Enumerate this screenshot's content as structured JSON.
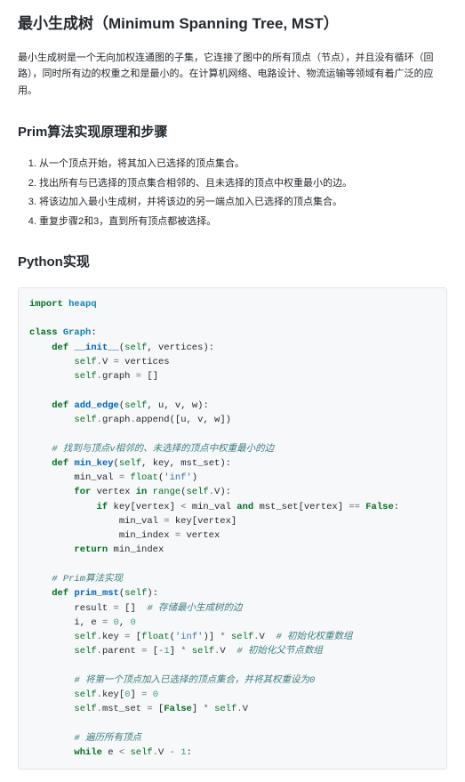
{
  "title": "最小生成树（Minimum Spanning Tree, MST）",
  "intro": "最小生成树是一个无向加权连通图的子集，它连接了图中的所有顶点（节点），并且没有循环（回路），同时所有边的权重之和是最小的。在计算机网络、电路设计、物流运输等领域有着广泛的应用。",
  "section_prim_title": "Prim算法实现原理和步骤",
  "prim_steps": [
    "从一个顶点开始，将其加入已选择的顶点集合。",
    "找出所有与已选择的顶点集合相邻的、且未选择的顶点中权重最小的边。",
    "将该边加入最小生成树，并将该边的另一端点加入已选择的顶点集合。",
    "重复步骤2和3，直到所有顶点都被选择。"
  ],
  "section_python_title": "Python实现",
  "code_tokens": [
    [
      "k",
      "import"
    ],
    [
      "n",
      " "
    ],
    [
      "nn",
      "heapq"
    ],
    [
      "nl",
      ""
    ],
    [
      "nl",
      ""
    ],
    [
      "k",
      "class"
    ],
    [
      "n",
      " "
    ],
    [
      "nc",
      "Graph"
    ],
    [
      "p",
      ":"
    ],
    [
      "nl",
      ""
    ],
    [
      "n",
      "    "
    ],
    [
      "k",
      "def"
    ],
    [
      "n",
      " "
    ],
    [
      "nf",
      "__init__"
    ],
    [
      "p",
      "("
    ],
    [
      "bp",
      "self"
    ],
    [
      "p",
      ","
    ],
    [
      "n",
      " vertices"
    ],
    [
      "p",
      ")"
    ],
    [
      "p",
      ":"
    ],
    [
      "nl",
      ""
    ],
    [
      "n",
      "        "
    ],
    [
      "bp",
      "self"
    ],
    [
      "o",
      "."
    ],
    [
      "n",
      "V "
    ],
    [
      "o",
      "="
    ],
    [
      "n",
      " vertices"
    ],
    [
      "nl",
      ""
    ],
    [
      "n",
      "        "
    ],
    [
      "bp",
      "self"
    ],
    [
      "o",
      "."
    ],
    [
      "n",
      "graph "
    ],
    [
      "o",
      "="
    ],
    [
      "n",
      " "
    ],
    [
      "p",
      "[]"
    ],
    [
      "nl",
      ""
    ],
    [
      "nl",
      ""
    ],
    [
      "n",
      "    "
    ],
    [
      "k",
      "def"
    ],
    [
      "n",
      " "
    ],
    [
      "nf",
      "add_edge"
    ],
    [
      "p",
      "("
    ],
    [
      "bp",
      "self"
    ],
    [
      "p",
      ","
    ],
    [
      "n",
      " u"
    ],
    [
      "p",
      ","
    ],
    [
      "n",
      " v"
    ],
    [
      "p",
      ","
    ],
    [
      "n",
      " w"
    ],
    [
      "p",
      ")"
    ],
    [
      "p",
      ":"
    ],
    [
      "nl",
      ""
    ],
    [
      "n",
      "        "
    ],
    [
      "bp",
      "self"
    ],
    [
      "o",
      "."
    ],
    [
      "n",
      "graph"
    ],
    [
      "o",
      "."
    ],
    [
      "n",
      "append"
    ],
    [
      "p",
      "(["
    ],
    [
      "n",
      "u"
    ],
    [
      "p",
      ","
    ],
    [
      "n",
      " v"
    ],
    [
      "p",
      ","
    ],
    [
      "n",
      " w"
    ],
    [
      "p",
      "])"
    ],
    [
      "nl",
      ""
    ],
    [
      "nl",
      ""
    ],
    [
      "n",
      "    "
    ],
    [
      "c",
      "# 找到与顶点v相邻的、未选择的顶点中权重最小的边"
    ],
    [
      "nl",
      ""
    ],
    [
      "n",
      "    "
    ],
    [
      "k",
      "def"
    ],
    [
      "n",
      " "
    ],
    [
      "nf",
      "min_key"
    ],
    [
      "p",
      "("
    ],
    [
      "bp",
      "self"
    ],
    [
      "p",
      ","
    ],
    [
      "n",
      " key"
    ],
    [
      "p",
      ","
    ],
    [
      "n",
      " mst_set"
    ],
    [
      "p",
      ")"
    ],
    [
      "p",
      ":"
    ],
    [
      "nl",
      ""
    ],
    [
      "n",
      "        min_val "
    ],
    [
      "o",
      "="
    ],
    [
      "n",
      " "
    ],
    [
      "nb",
      "float"
    ],
    [
      "p",
      "("
    ],
    [
      "s",
      "'inf'"
    ],
    [
      "p",
      ")"
    ],
    [
      "nl",
      ""
    ],
    [
      "n",
      "        "
    ],
    [
      "k",
      "for"
    ],
    [
      "n",
      " vertex "
    ],
    [
      "k",
      "in"
    ],
    [
      "n",
      " "
    ],
    [
      "nb",
      "range"
    ],
    [
      "p",
      "("
    ],
    [
      "bp",
      "self"
    ],
    [
      "o",
      "."
    ],
    [
      "n",
      "V"
    ],
    [
      "p",
      ")"
    ],
    [
      "p",
      ":"
    ],
    [
      "nl",
      ""
    ],
    [
      "n",
      "            "
    ],
    [
      "k",
      "if"
    ],
    [
      "n",
      " key"
    ],
    [
      "p",
      "["
    ],
    [
      "n",
      "vertex"
    ],
    [
      "p",
      "]"
    ],
    [
      "n",
      " "
    ],
    [
      "o",
      "<"
    ],
    [
      "n",
      " min_val "
    ],
    [
      "k",
      "and"
    ],
    [
      "n",
      " mst_set"
    ],
    [
      "p",
      "["
    ],
    [
      "n",
      "vertex"
    ],
    [
      "p",
      "]"
    ],
    [
      "n",
      " "
    ],
    [
      "o",
      "=="
    ],
    [
      "n",
      " "
    ],
    [
      "kc",
      "False"
    ],
    [
      "p",
      ":"
    ],
    [
      "nl",
      ""
    ],
    [
      "n",
      "                min_val "
    ],
    [
      "o",
      "="
    ],
    [
      "n",
      " key"
    ],
    [
      "p",
      "["
    ],
    [
      "n",
      "vertex"
    ],
    [
      "p",
      "]"
    ],
    [
      "nl",
      ""
    ],
    [
      "n",
      "                min_index "
    ],
    [
      "o",
      "="
    ],
    [
      "n",
      " vertex"
    ],
    [
      "nl",
      ""
    ],
    [
      "n",
      "        "
    ],
    [
      "k",
      "return"
    ],
    [
      "n",
      " min_index"
    ],
    [
      "nl",
      ""
    ],
    [
      "nl",
      ""
    ],
    [
      "n",
      "    "
    ],
    [
      "c",
      "# Prim算法实现"
    ],
    [
      "nl",
      ""
    ],
    [
      "n",
      "    "
    ],
    [
      "k",
      "def"
    ],
    [
      "n",
      " "
    ],
    [
      "nf",
      "prim_mst"
    ],
    [
      "p",
      "("
    ],
    [
      "bp",
      "self"
    ],
    [
      "p",
      ")"
    ],
    [
      "p",
      ":"
    ],
    [
      "nl",
      ""
    ],
    [
      "n",
      "        result "
    ],
    [
      "o",
      "="
    ],
    [
      "n",
      " "
    ],
    [
      "p",
      "[]"
    ],
    [
      "n",
      "  "
    ],
    [
      "c",
      "# 存储最小生成树的边"
    ],
    [
      "nl",
      ""
    ],
    [
      "n",
      "        i"
    ],
    [
      "p",
      ","
    ],
    [
      "n",
      " e "
    ],
    [
      "o",
      "="
    ],
    [
      "n",
      " "
    ],
    [
      "mi",
      "0"
    ],
    [
      "p",
      ","
    ],
    [
      "n",
      " "
    ],
    [
      "mi",
      "0"
    ],
    [
      "nl",
      ""
    ],
    [
      "n",
      "        "
    ],
    [
      "bp",
      "self"
    ],
    [
      "o",
      "."
    ],
    [
      "n",
      "key "
    ],
    [
      "o",
      "="
    ],
    [
      "n",
      " "
    ],
    [
      "p",
      "["
    ],
    [
      "nb",
      "float"
    ],
    [
      "p",
      "("
    ],
    [
      "s",
      "'inf'"
    ],
    [
      "p",
      ")]"
    ],
    [
      "n",
      " "
    ],
    [
      "o",
      "*"
    ],
    [
      "n",
      " "
    ],
    [
      "bp",
      "self"
    ],
    [
      "o",
      "."
    ],
    [
      "n",
      "V  "
    ],
    [
      "c",
      "# 初始化权重数组"
    ],
    [
      "nl",
      ""
    ],
    [
      "n",
      "        "
    ],
    [
      "bp",
      "self"
    ],
    [
      "o",
      "."
    ],
    [
      "n",
      "parent "
    ],
    [
      "o",
      "="
    ],
    [
      "n",
      " "
    ],
    [
      "p",
      "["
    ],
    [
      "o",
      "-"
    ],
    [
      "mi",
      "1"
    ],
    [
      "p",
      "]"
    ],
    [
      "n",
      " "
    ],
    [
      "o",
      "*"
    ],
    [
      "n",
      " "
    ],
    [
      "bp",
      "self"
    ],
    [
      "o",
      "."
    ],
    [
      "n",
      "V  "
    ],
    [
      "c",
      "# 初始化父节点数组"
    ],
    [
      "nl",
      ""
    ],
    [
      "nl",
      ""
    ],
    [
      "n",
      "        "
    ],
    [
      "c",
      "# 将第一个顶点加入已选择的顶点集合，并将其权重设为0"
    ],
    [
      "nl",
      ""
    ],
    [
      "n",
      "        "
    ],
    [
      "bp",
      "self"
    ],
    [
      "o",
      "."
    ],
    [
      "n",
      "key"
    ],
    [
      "p",
      "["
    ],
    [
      "mi",
      "0"
    ],
    [
      "p",
      "]"
    ],
    [
      "n",
      " "
    ],
    [
      "o",
      "="
    ],
    [
      "n",
      " "
    ],
    [
      "mi",
      "0"
    ],
    [
      "nl",
      ""
    ],
    [
      "n",
      "        "
    ],
    [
      "bp",
      "self"
    ],
    [
      "o",
      "."
    ],
    [
      "n",
      "mst_set "
    ],
    [
      "o",
      "="
    ],
    [
      "n",
      " "
    ],
    [
      "p",
      "["
    ],
    [
      "kc",
      "False"
    ],
    [
      "p",
      "]"
    ],
    [
      "n",
      " "
    ],
    [
      "o",
      "*"
    ],
    [
      "n",
      " "
    ],
    [
      "bp",
      "self"
    ],
    [
      "o",
      "."
    ],
    [
      "n",
      "V"
    ],
    [
      "nl",
      ""
    ],
    [
      "nl",
      ""
    ],
    [
      "n",
      "        "
    ],
    [
      "c",
      "# 遍历所有顶点"
    ],
    [
      "nl",
      ""
    ],
    [
      "n",
      "        "
    ],
    [
      "k",
      "while"
    ],
    [
      "n",
      " e "
    ],
    [
      "o",
      "<"
    ],
    [
      "n",
      " "
    ],
    [
      "bp",
      "self"
    ],
    [
      "o",
      "."
    ],
    [
      "n",
      "V "
    ],
    [
      "o",
      "-"
    ],
    [
      "n",
      " "
    ],
    [
      "mi",
      "1"
    ],
    [
      "p",
      ":"
    ]
  ]
}
